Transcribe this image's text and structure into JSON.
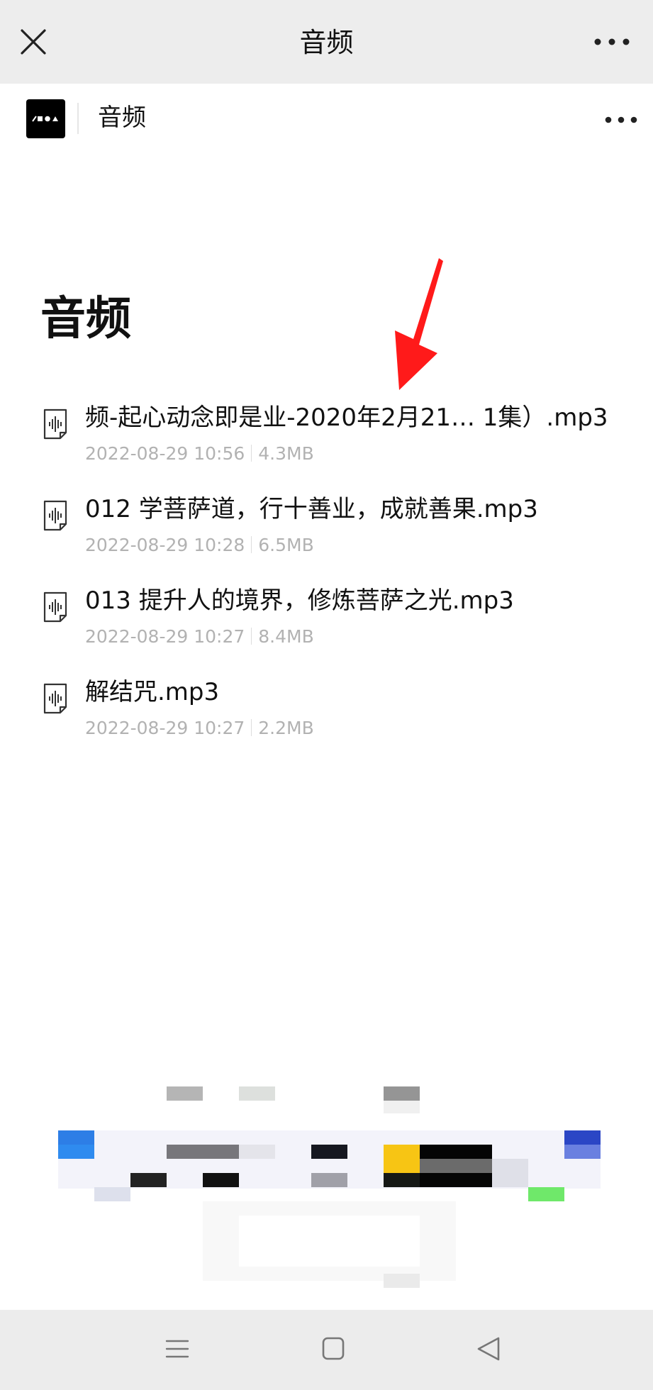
{
  "window": {
    "title": "音频",
    "close_icon": "close-icon",
    "more_icon": "more-horizontal-icon"
  },
  "account": {
    "name": "音频",
    "logo_icon": "account-logo-icon",
    "more_icon": "more-horizontal-icon"
  },
  "page": {
    "heading": "音频"
  },
  "files": [
    {
      "name": "频-起心动念即是业-2020年2月21… 1集）.mp3",
      "date": "2022-08-29 10:56",
      "size": "4.3MB",
      "icon": "audio-file-icon"
    },
    {
      "name": "012 学菩萨道，行十善业，成就善果.mp3",
      "date": "2022-08-29 10:28",
      "size": "6.5MB",
      "icon": "audio-file-icon"
    },
    {
      "name": "013 提升人的境界，修炼菩萨之光.mp3",
      "date": "2022-08-29 10:27",
      "size": "8.4MB",
      "icon": "audio-file-icon"
    },
    {
      "name": "解结咒.mp3",
      "date": "2022-08-29 10:27",
      "size": "2.2MB",
      "icon": "audio-file-icon"
    }
  ],
  "annotation": {
    "icon": "red-arrow-icon",
    "color": "#ff1a1a"
  },
  "navbar": {
    "menu_icon": "menu-icon",
    "home_icon": "home-square-icon",
    "back_icon": "back-triangle-icon"
  }
}
